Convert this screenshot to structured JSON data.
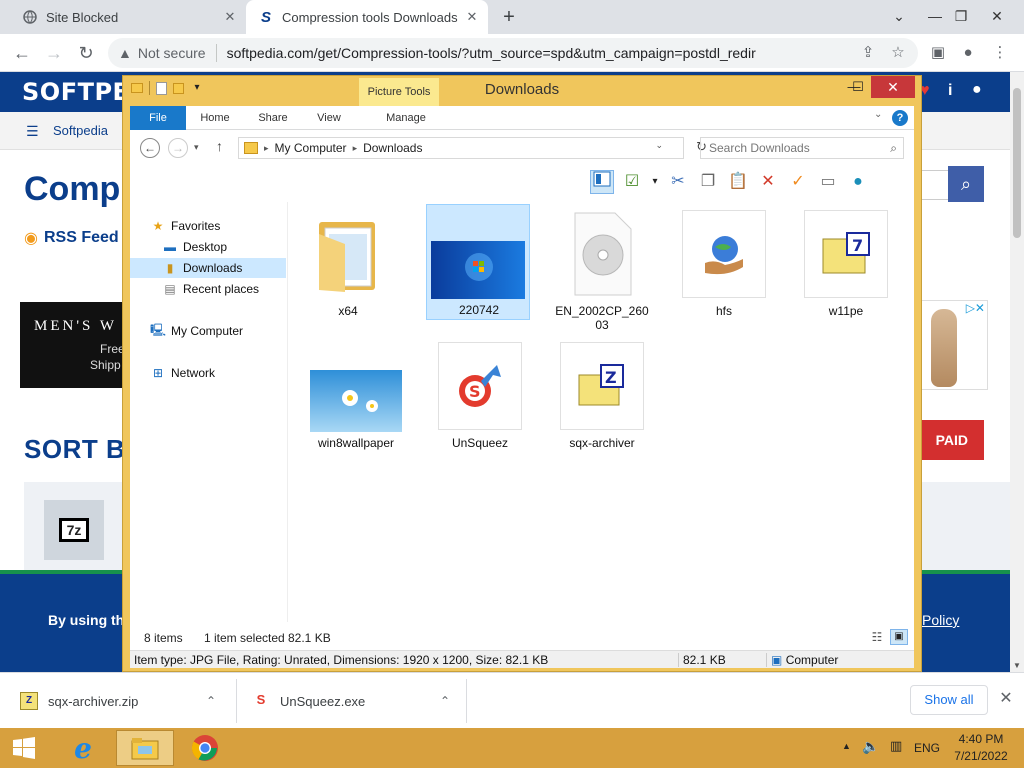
{
  "browser": {
    "tabs": [
      {
        "title": "Site Blocked",
        "close": "✕"
      },
      {
        "title": "Compression tools Downloads",
        "close": "✕"
      }
    ],
    "new_tab": "+",
    "window_controls": {
      "collapse": "⌄",
      "minimize": "—",
      "restore": "❐",
      "close": "✕"
    },
    "address": {
      "security": "Not secure",
      "url": "softpedia.com/get/Compression-tools/?utm_source=spd&utm_campaign=postdl_redir"
    }
  },
  "softpedia": {
    "logo": "SOFTPE",
    "breadcrumb": "Softpedia",
    "title": "Compr",
    "rss": "RSS Feed",
    "ad_text_1": "MEN'S W",
    "ad_text_2": "Free",
    "ad_text_3": "Shipp",
    "sort_by": "SORT BY:",
    "paid": "PAID",
    "footer_left": "By using the s",
    "footer_right": "Policy",
    "card_icon": "7z"
  },
  "explorer": {
    "title": "Downloads",
    "picture_tools": "Picture Tools",
    "ribbon_tabs": {
      "file": "File",
      "home": "Home",
      "share": "Share",
      "view": "View",
      "manage": "Manage"
    },
    "address_path": [
      "My Computer",
      "Downloads"
    ],
    "search_placeholder": "Search Downloads",
    "nav": {
      "favorites": "Favorites",
      "desktop": "Desktop",
      "downloads": "Downloads",
      "recent": "Recent places",
      "computer": "My Computer",
      "network": "Network"
    },
    "files": [
      {
        "name": "x64",
        "icon": "folder-icon"
      },
      {
        "name": "220742",
        "icon": "image-thumbnail",
        "selected": true
      },
      {
        "name": "EN_2002CP_26003",
        "icon": "disc-image-icon"
      },
      {
        "name": "hfs",
        "icon": "globe-hand-icon"
      },
      {
        "name": "w11pe",
        "icon": "7z-archive-icon"
      },
      {
        "name": "win8wallpaper",
        "icon": "image-thumbnail"
      },
      {
        "name": "UnSqueez",
        "icon": "unsqueez-app-icon"
      },
      {
        "name": "sqx-archiver",
        "icon": "sqx-archive-icon"
      }
    ],
    "status": {
      "items": "8 items",
      "selected": "1 item selected",
      "size": "82.1 KB"
    },
    "details": {
      "info": "Item type: JPG File, Rating: Unrated, Dimensions: 1920 x 1200, Size: 82.1 KB",
      "size": "82.1 KB",
      "location": "Computer"
    }
  },
  "downloads_bar": {
    "items": [
      {
        "name": "sqx-archiver.zip"
      },
      {
        "name": "UnSqueez.exe"
      }
    ],
    "show_all": "Show all"
  },
  "taskbar": {
    "language": "ENG",
    "time": "4:40 PM",
    "date": "7/21/2022"
  },
  "colors": {
    "softpedia_blue": "#0b3e8b",
    "window_frame": "#f0c65c",
    "taskbar": "#d7a03e",
    "selection": "#cce8ff",
    "close_red": "#c7373a"
  }
}
